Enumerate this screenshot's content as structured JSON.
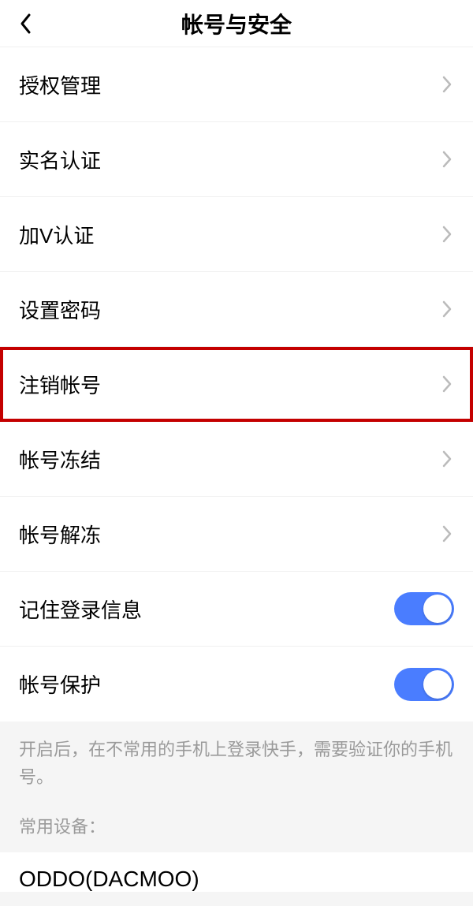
{
  "header": {
    "title": "帐号与安全"
  },
  "items": [
    {
      "label": "授权管理"
    },
    {
      "label": "实名认证"
    },
    {
      "label": "加V认证"
    },
    {
      "label": "设置密码"
    },
    {
      "label": "注销帐号",
      "highlighted": true
    },
    {
      "label": "帐号冻结"
    },
    {
      "label": "帐号解冻"
    }
  ],
  "toggles": [
    {
      "label": "记住登录信息",
      "on": true
    },
    {
      "label": "帐号保护",
      "on": true
    }
  ],
  "footer": {
    "hint": "开启后，在不常用的手机上登录快手，需要验证你的手机号。",
    "devices_label": "常用设备：",
    "device_partial": "ODDO(DACMOO)"
  }
}
